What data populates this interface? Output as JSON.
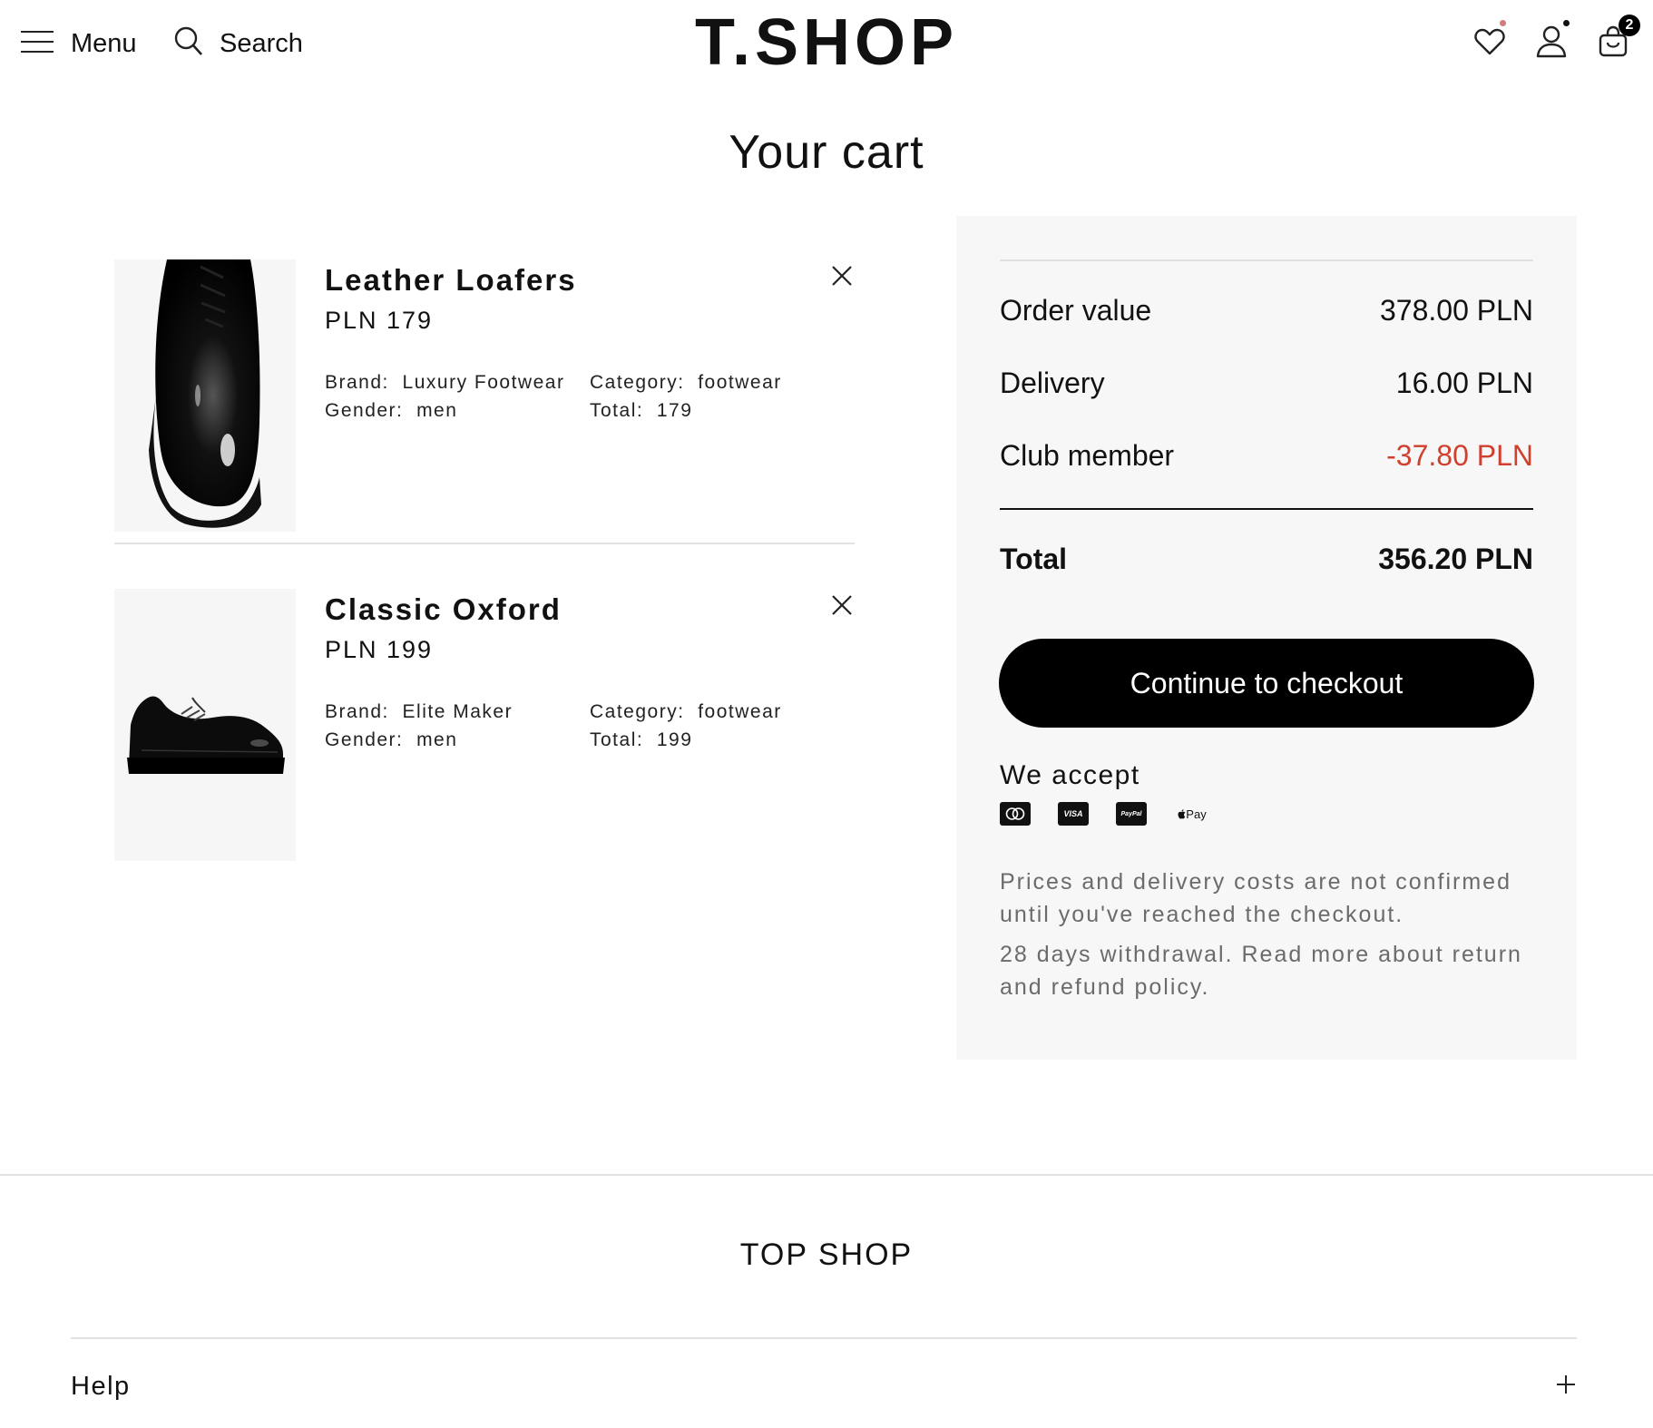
{
  "header": {
    "menu_label": "Menu",
    "search_label": "Search",
    "logo": "T.SHOP",
    "wishlist_dot_color": "#d27b7b",
    "bag_count": "2"
  },
  "page": {
    "title": "Your cart"
  },
  "cart": {
    "items": [
      {
        "name": "Leather Loafers",
        "price": "PLN 179",
        "brand_label": "Brand:",
        "brand": "Luxury Footwear",
        "gender_label": "Gender:",
        "gender": "men",
        "category_label": "Category:",
        "category": "footwear",
        "total_label": "Total:",
        "total": "179"
      },
      {
        "name": "Classic Oxford",
        "price": "PLN 199",
        "brand_label": "Brand:",
        "brand": "Elite Maker",
        "gender_label": "Gender:",
        "gender": "men",
        "category_label": "Category:",
        "category": "footwear",
        "total_label": "Total:",
        "total": "199"
      }
    ]
  },
  "summary": {
    "order_value_label": "Order value",
    "order_value": "378.00 PLN",
    "delivery_label": "Delivery",
    "delivery": "16.00 PLN",
    "club_label": "Club member",
    "club": "-37.80 PLN",
    "club_color": "#d0402f",
    "total_label": "Total",
    "total": "356.20 PLN",
    "checkout_label": "Continue to checkout",
    "accept_title": "We accept",
    "payments": [
      "mastercard-icon",
      "visa-icon",
      "paypal-icon",
      "apple-pay-icon"
    ],
    "visa_text": "VISA",
    "paypal_text": "PayPal",
    "applepay_text": "Pay",
    "note1": "Prices and delivery costs are not confirmed until you've reached the checkout.",
    "note2": "28 days withdrawal. Read more about return and refund policy."
  },
  "footer": {
    "brand": "TOP SHOP",
    "help_label": "Help"
  }
}
